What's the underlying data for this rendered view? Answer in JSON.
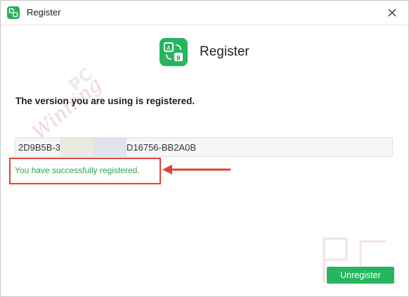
{
  "window": {
    "title": "Register",
    "app_icon": "translate-ab-icon",
    "close_icon": "close-icon"
  },
  "main": {
    "heading": "Register",
    "status_text": "The version you are using is registered.",
    "license_key": {
      "prefix": "2D9B5B-3",
      "suffix": "D16756-BB2A0B"
    },
    "success_message": "You have successfully registered.",
    "unregister_label": "Unregister"
  },
  "colors": {
    "accent_green": "#27b55f",
    "success_text": "#2aa34d",
    "highlight_red": "#e0413d"
  }
}
